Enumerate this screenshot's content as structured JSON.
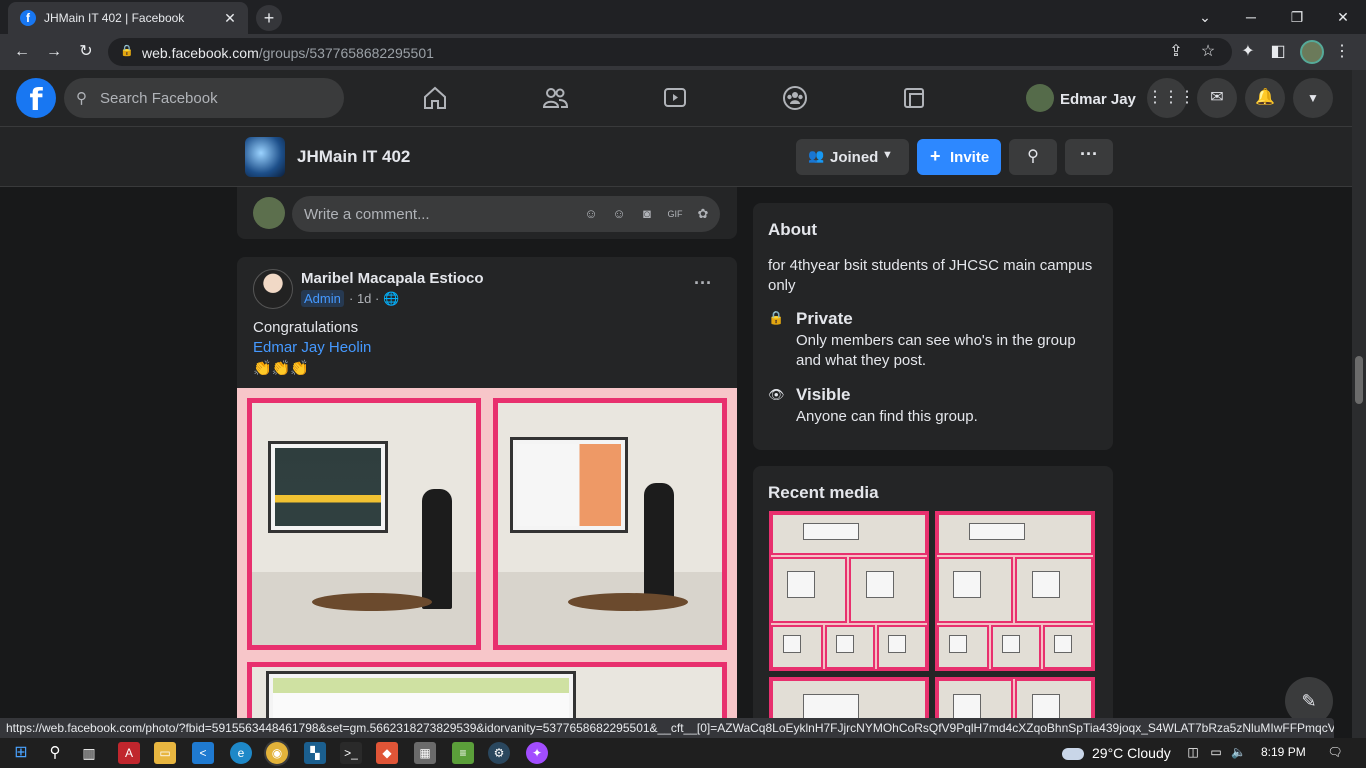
{
  "browser": {
    "tab_title": "JHMain IT 402 | Facebook",
    "url_host": "web.facebook.com",
    "url_path": "/groups/5377658682295501",
    "status_url": "https://web.facebook.com/photo/?fbid=5915563448461798&set=gm.5662318273829539&idorvanity=5377658682295501&__cft__[0]=AZWaCq8LoEyklnH7FJjrcNYMOhCoRsQfV9PqlH7md4cXZqoBhnSpTia439joqx_S4WLAT7bRza5zNluMIwFFPmqcVO..."
  },
  "fb": {
    "search_placeholder": "Search Facebook",
    "user_name": "Edmar Jay",
    "logo_letter": "f"
  },
  "group": {
    "name": "JHMain IT 402",
    "joined_label": "Joined",
    "invite_label": "Invite"
  },
  "comment": {
    "placeholder": "Write a comment..."
  },
  "post": {
    "author": "Maribel Macapala Estioco",
    "badge": "Admin",
    "time": "· 1d ·",
    "line1": "Congratulations",
    "mention": "Edmar Jay Heolin",
    "emojis": "👏👏👏"
  },
  "about": {
    "title": "About",
    "description": "for 4thyear bsit students of JHCSC main campus only",
    "private_title": "Private",
    "private_desc": "Only members can see who's in the group and what they post.",
    "visible_title": "Visible",
    "visible_desc": "Anyone can find this group."
  },
  "media": {
    "title": "Recent media"
  },
  "taskbar": {
    "weather": "29°C  Cloudy",
    "time": "8:19 PM"
  },
  "colors": {
    "fb_blue": "#1877f2",
    "invite_blue": "#2d88ff",
    "link_blue": "#4599ff",
    "frame_pink": "#e8306e"
  },
  "icons": [
    "home-icon",
    "friends-icon",
    "watch-icon",
    "groups-icon",
    "gaming-icon",
    "menu-grid-icon",
    "messenger-icon",
    "notifications-icon",
    "account-caret-icon"
  ]
}
